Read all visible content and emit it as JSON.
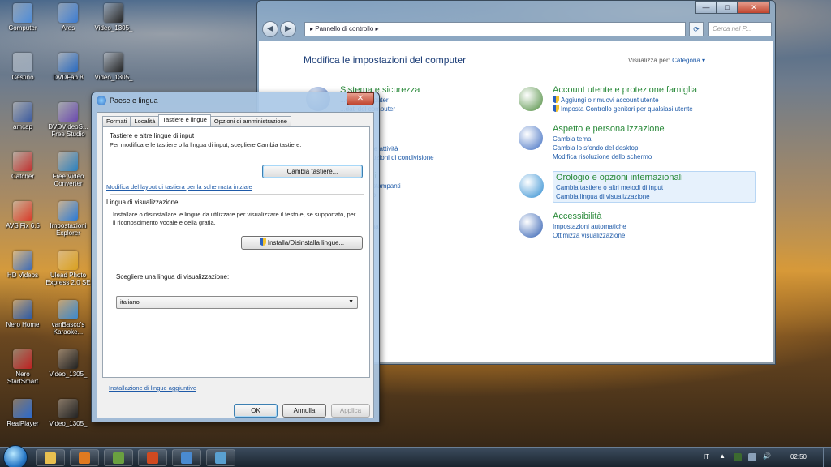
{
  "desktop": {
    "icons": [
      {
        "label": "Computer",
        "color": "#4a8ad8"
      },
      {
        "label": "Ares",
        "color": "#3a7ad0"
      },
      {
        "label": "Video_1305_",
        "color": "#222222"
      },
      {
        "label": "Cestino",
        "color": "#9aa8b8"
      },
      {
        "label": "DVDFab 8",
        "color": "#2a6ac0"
      },
      {
        "label": "Video_1305_",
        "color": "#222222"
      },
      {
        "label": "amcap",
        "color": "#3a5aa0"
      },
      {
        "label": "DVDVideoS... Free Studio",
        "color": "#6a4ab0"
      },
      {
        "label": "Catcher",
        "color": "#c03030"
      },
      {
        "label": "Free Video Converter",
        "color": "#2a80c0"
      },
      {
        "label": "AVS Fix 6.5",
        "color": "#d83a2a"
      },
      {
        "label": "Impostazioni Explorer",
        "color": "#2a7ad8"
      },
      {
        "label": "HD Videos",
        "color": "#3a6ab8"
      },
      {
        "label": "Ulead Photo Express 2.0 SE",
        "color": "#d8a020"
      },
      {
        "label": "Nero Home",
        "color": "#2a5aa8"
      },
      {
        "label": "vanBasco's Karaoke...",
        "color": "#3a8ad0"
      },
      {
        "label": "Nero StartSmart",
        "color": "#c02020"
      },
      {
        "label": "Video_1305_",
        "color": "#222222"
      },
      {
        "label": "RealPlayer",
        "color": "#2a6ad0"
      },
      {
        "label": "Video_1305_",
        "color": "#222222"
      }
    ]
  },
  "control_panel": {
    "address": "▸ Pannello di controllo ▸",
    "search_placeholder": "Cerca nel P...",
    "heading": "Modifica le impostazioni del computer",
    "view_by_label": "Visualizza per:",
    "view_by_value": "Categoria ▾",
    "left_categories": [
      {
        "title": "Sistema e sicurezza",
        "links": [
          "...e del computer",
          "...dati del computer",
          "...problemi"
        ],
        "color": "#3a6ac0"
      },
      {
        "title": "...rnet",
        "links": [
          "...della rete e attività",
          "...home e opzioni di condivisione"
        ],
        "color": "#3a7ad0"
      },
      {
        "title": "...e suoni",
        "links": [
          "...positivi e stampanti",
          "...dispositivo"
        ],
        "color": "#6a6a7a"
      },
      {
        "title": "...i",
        "links": [
          "...programma"
        ],
        "color": "#5a8a3a"
      }
    ],
    "right_categories": [
      {
        "title": "Account utente e protezione famiglia",
        "links": [
          "Aggiungi o rimuovi account utente",
          "Imposta Controllo genitori per qualsiasi utente"
        ],
        "color": "#4a8a3a"
      },
      {
        "title": "Aspetto e personalizzazione",
        "links": [
          "Cambia tema",
          "Cambia lo sfondo del desktop",
          "Modifica risoluzione dello schermo"
        ],
        "color": "#3a6ac0"
      },
      {
        "title": "Orologio e opzioni internazionali",
        "links": [
          "Cambia tastiere o altri metodi di input",
          "Cambia lingua di visualizzazione"
        ],
        "color": "#2a8ad0"
      },
      {
        "title": "Accessibilità",
        "links": [
          "Impostazioni automatiche",
          "Ottimizza visualizzazione"
        ],
        "color": "#2a5ab0"
      }
    ]
  },
  "dialog": {
    "title": "Paese e lingua",
    "tabs": [
      "Formati",
      "Località",
      "Tastiere e lingue",
      "Opzioni di amministrazione"
    ],
    "keyboard_group_title": "Tastiere e altre lingue di input",
    "keyboard_group_text": "Per modificare le tastiere o la lingua di input, scegliere Cambia tastiere.",
    "change_keyboards_button": "Cambia tastiere...",
    "keyboard_layout_link": "Modifica del layout di tastiera per la schermata iniziale",
    "display_group_title": "Lingua di visualizzazione",
    "display_group_text": "Installare o disinstallare le lingue da utilizzare per visualizzare il testo e, se supportato, per il riconoscimento vocale e della grafia.",
    "install_button": "Installa/Disinstalla lingue...",
    "choose_language_label": "Scegliere una lingua di visualizzazione:",
    "selected_language": "italiano",
    "additional_languages_link": "Installazione di lingue aggiuntive",
    "ok_button": "OK",
    "cancel_button": "Annulla",
    "apply_button": "Applica"
  },
  "taskbar": {
    "buttons": [
      {
        "name": "explorer",
        "color": "#e8c050"
      },
      {
        "name": "media-player",
        "color": "#e07a20"
      },
      {
        "name": "app-1",
        "color": "#6aa040"
      },
      {
        "name": "firefox",
        "color": "#d04a20"
      },
      {
        "name": "control-panel",
        "color": "#4a8ad0"
      },
      {
        "name": "region-dialog",
        "color": "#5aa0d0"
      }
    ],
    "language": "IT",
    "clock": "02:50"
  }
}
